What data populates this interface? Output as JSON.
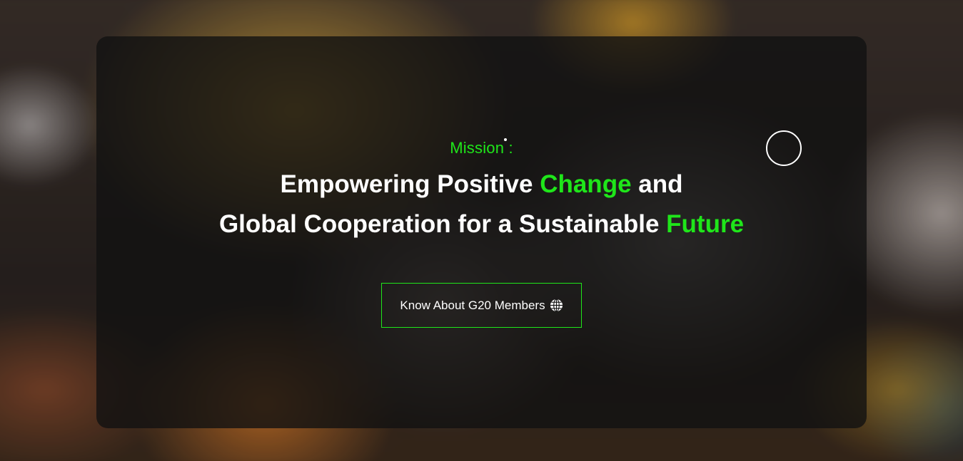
{
  "mission": {
    "label": "Mission :",
    "headline_line1": {
      "before": "Empowering Positive ",
      "highlight": "Change",
      "after": " and"
    },
    "headline_line2": {
      "before": "Global Cooperation for a Sustainable ",
      "highlight": "Future"
    }
  },
  "cta": {
    "label": "Know About G20 Members",
    "icon": "globe-icon"
  },
  "colors": {
    "accent": "#1fe61a",
    "text": "#ffffff",
    "overlay": "#121212"
  }
}
